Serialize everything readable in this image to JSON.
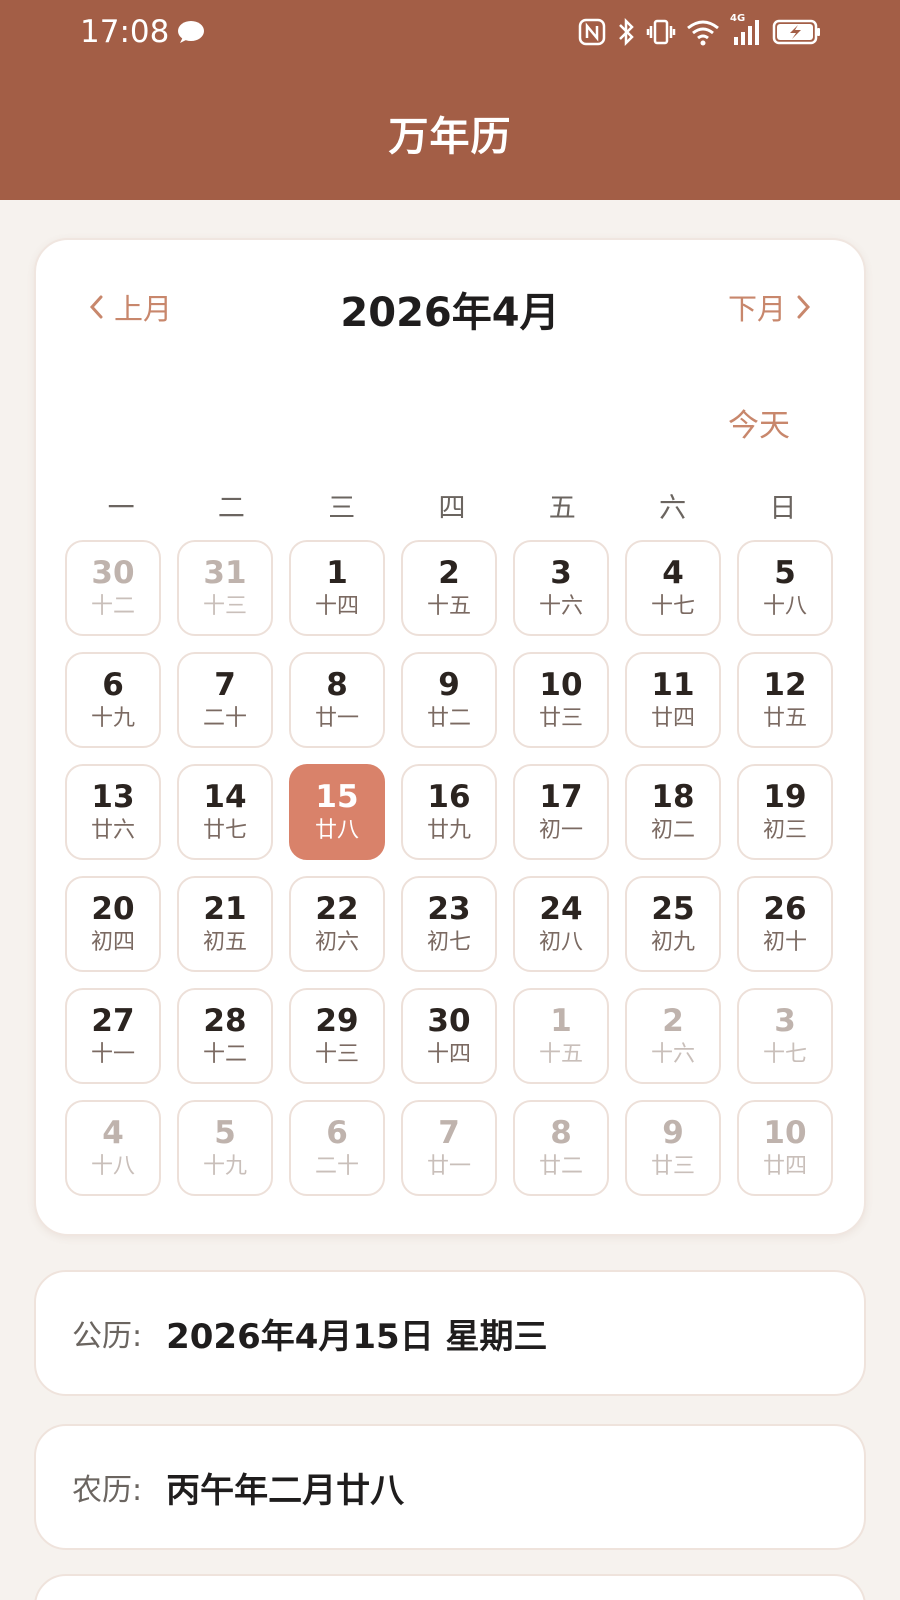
{
  "status_bar": {
    "time": "17:08",
    "network": "4G"
  },
  "header": {
    "title": "万年历"
  },
  "calendar": {
    "prev_label": "上月",
    "next_label": "下月",
    "month_title": "2026年4月",
    "today_label": "今天",
    "weekdays": [
      "一",
      "二",
      "三",
      "四",
      "五",
      "六",
      "日"
    ],
    "days": [
      {
        "d": "30",
        "l": "十二",
        "other": true
      },
      {
        "d": "31",
        "l": "十三",
        "other": true
      },
      {
        "d": "1",
        "l": "十四"
      },
      {
        "d": "2",
        "l": "十五"
      },
      {
        "d": "3",
        "l": "十六"
      },
      {
        "d": "4",
        "l": "十七"
      },
      {
        "d": "5",
        "l": "十八"
      },
      {
        "d": "6",
        "l": "十九"
      },
      {
        "d": "7",
        "l": "二十"
      },
      {
        "d": "8",
        "l": "廿一"
      },
      {
        "d": "9",
        "l": "廿二"
      },
      {
        "d": "10",
        "l": "廿三"
      },
      {
        "d": "11",
        "l": "廿四"
      },
      {
        "d": "12",
        "l": "廿五"
      },
      {
        "d": "13",
        "l": "廿六"
      },
      {
        "d": "14",
        "l": "廿七"
      },
      {
        "d": "15",
        "l": "廿八",
        "selected": true
      },
      {
        "d": "16",
        "l": "廿九"
      },
      {
        "d": "17",
        "l": "初一"
      },
      {
        "d": "18",
        "l": "初二"
      },
      {
        "d": "19",
        "l": "初三"
      },
      {
        "d": "20",
        "l": "初四"
      },
      {
        "d": "21",
        "l": "初五"
      },
      {
        "d": "22",
        "l": "初六"
      },
      {
        "d": "23",
        "l": "初七"
      },
      {
        "d": "24",
        "l": "初八"
      },
      {
        "d": "25",
        "l": "初九"
      },
      {
        "d": "26",
        "l": "初十"
      },
      {
        "d": "27",
        "l": "十一"
      },
      {
        "d": "28",
        "l": "十二"
      },
      {
        "d": "29",
        "l": "十三"
      },
      {
        "d": "30",
        "l": "十四"
      },
      {
        "d": "1",
        "l": "十五",
        "other": true
      },
      {
        "d": "2",
        "l": "十六",
        "other": true
      },
      {
        "d": "3",
        "l": "十七",
        "other": true
      },
      {
        "d": "4",
        "l": "十八",
        "other": true
      },
      {
        "d": "5",
        "l": "十九",
        "other": true
      },
      {
        "d": "6",
        "l": "二十",
        "other": true
      },
      {
        "d": "7",
        "l": "廿一",
        "other": true
      },
      {
        "d": "8",
        "l": "廿二",
        "other": true
      },
      {
        "d": "9",
        "l": "廿三",
        "other": true
      },
      {
        "d": "10",
        "l": "廿四",
        "other": true
      }
    ]
  },
  "info": {
    "solar_label": "公历:",
    "solar_value": "2026年4月15日 星期三",
    "lunar_label": "农历:",
    "lunar_value": "丙午年二月廿八"
  },
  "colors": {
    "header_bg": "#a35e46",
    "accent": "#c8876c",
    "selected": "#d9826a"
  }
}
